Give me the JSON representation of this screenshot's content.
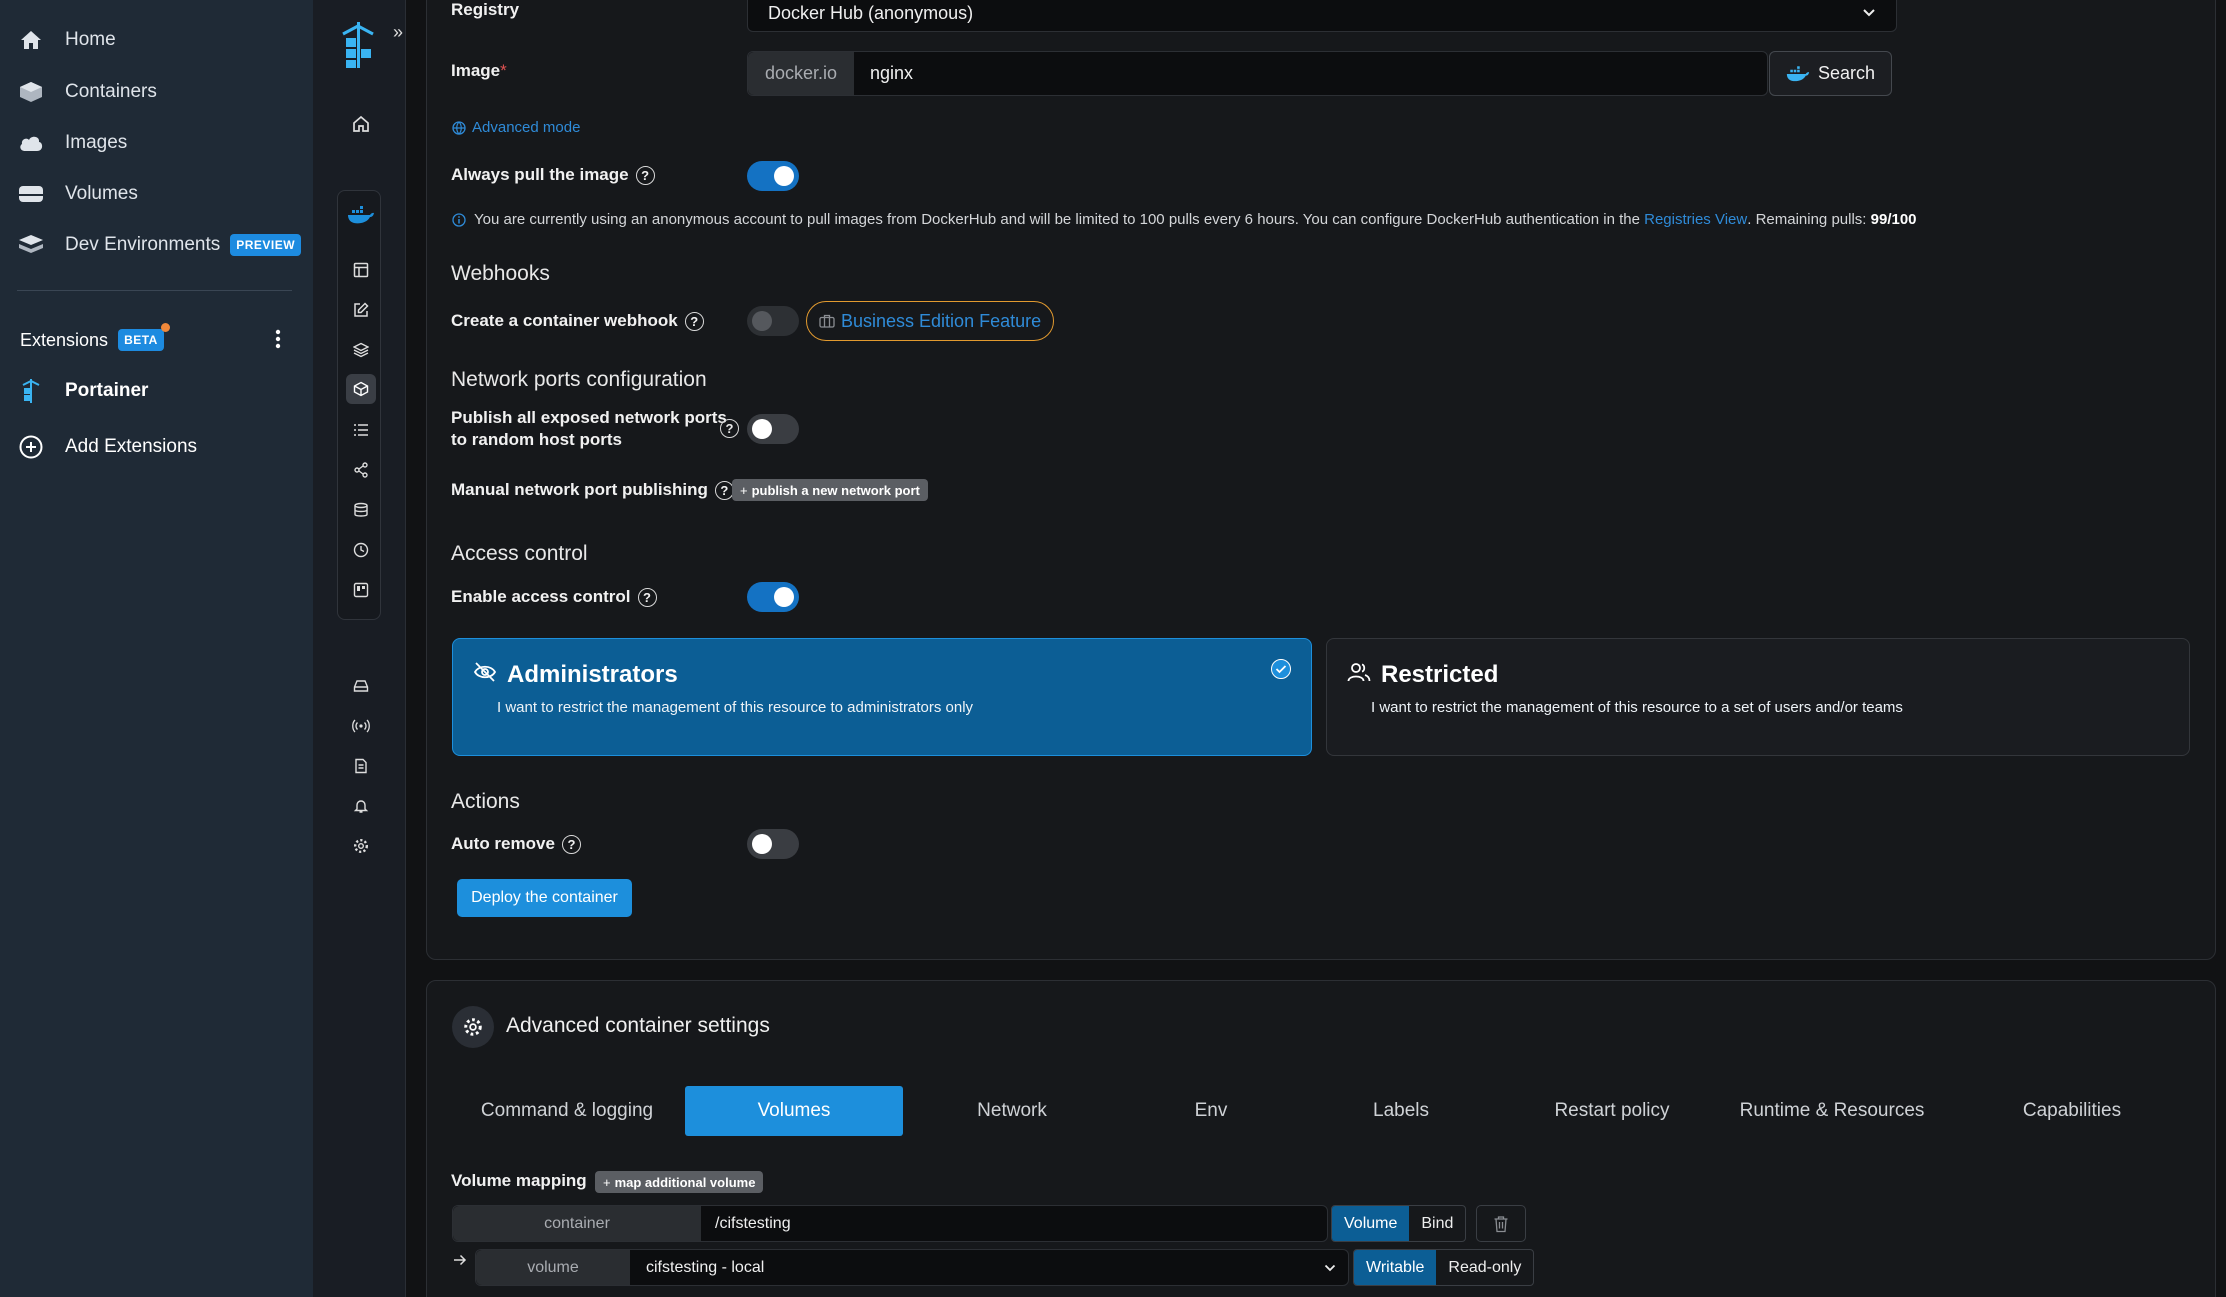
{
  "docker_sidebar": {
    "items": [
      {
        "label": "Home"
      },
      {
        "label": "Containers"
      },
      {
        "label": "Images"
      },
      {
        "label": "Volumes"
      },
      {
        "label": "Dev Environments",
        "badge": "PREVIEW"
      }
    ],
    "extensions": {
      "label": "Extensions",
      "badge": "BETA"
    },
    "extension_items": [
      {
        "label": "Portainer"
      },
      {
        "label": "Add Extensions"
      }
    ]
  },
  "form": {
    "registry": {
      "label": "Registry",
      "value": "Docker Hub (anonymous)"
    },
    "image": {
      "label": "Image",
      "required_mark": "*",
      "prefix": "docker.io",
      "value": "nginx",
      "search_label": "Search"
    },
    "advanced_mode": "Advanced mode",
    "always_pull": {
      "label": "Always pull the image",
      "enabled": true
    },
    "dockerhub_notice": {
      "text": "You are currently using an anonymous account to pull images from DockerHub and will be limited to 100 pulls every 6 hours. You can configure DockerHub authentication in the",
      "link": "Registries View",
      "suffix": ". Remaining pulls:",
      "remaining": "99/100"
    },
    "webhooks": {
      "title": "Webhooks",
      "create_label": "Create a container webhook",
      "enabled": false,
      "be_feature": "Business Edition Feature"
    },
    "network_ports": {
      "title": "Network ports configuration",
      "publish_all_line1": "Publish all exposed network ports",
      "publish_all_line2": "to random host ports",
      "publish_all_enabled": false,
      "manual_label": "Manual network port publishing",
      "manual_button": "publish a new network port"
    },
    "access_control": {
      "title": "Access control",
      "enable_label": "Enable access control",
      "enabled": true,
      "options": [
        {
          "title": "Administrators",
          "description": "I want to restrict the management of this resource to administrators only",
          "selected": true
        },
        {
          "title": "Restricted",
          "description": "I want to restrict the management of this resource to a set of users and/or teams",
          "selected": false
        }
      ]
    },
    "actions": {
      "title": "Actions",
      "auto_remove_label": "Auto remove",
      "auto_remove_enabled": false,
      "deploy_label": "Deploy the container"
    }
  },
  "advanced": {
    "title": "Advanced container settings",
    "tabs": [
      {
        "label": "Command & logging"
      },
      {
        "label": "Volumes",
        "active": true
      },
      {
        "label": "Network"
      },
      {
        "label": "Env"
      },
      {
        "label": "Labels"
      },
      {
        "label": "Restart policy"
      },
      {
        "label": "Runtime & Resources"
      },
      {
        "label": "Capabilities"
      }
    ],
    "volume_mapping": {
      "label": "Volume mapping",
      "add_button": "map additional volume",
      "container_addon": "container",
      "container_value": "/cifstesting",
      "type_options": [
        "Volume",
        "Bind"
      ],
      "type_selected": "Volume",
      "volume_addon": "volume",
      "volume_value": "cifstesting - local",
      "mode_options": [
        "Writable",
        "Read-only"
      ],
      "mode_selected": "Writable"
    }
  },
  "colors": {
    "accent": "#1d8fdc",
    "selected_card": "#0c5e95",
    "be_border": "#e29a2f",
    "link": "#2f8bd8"
  }
}
